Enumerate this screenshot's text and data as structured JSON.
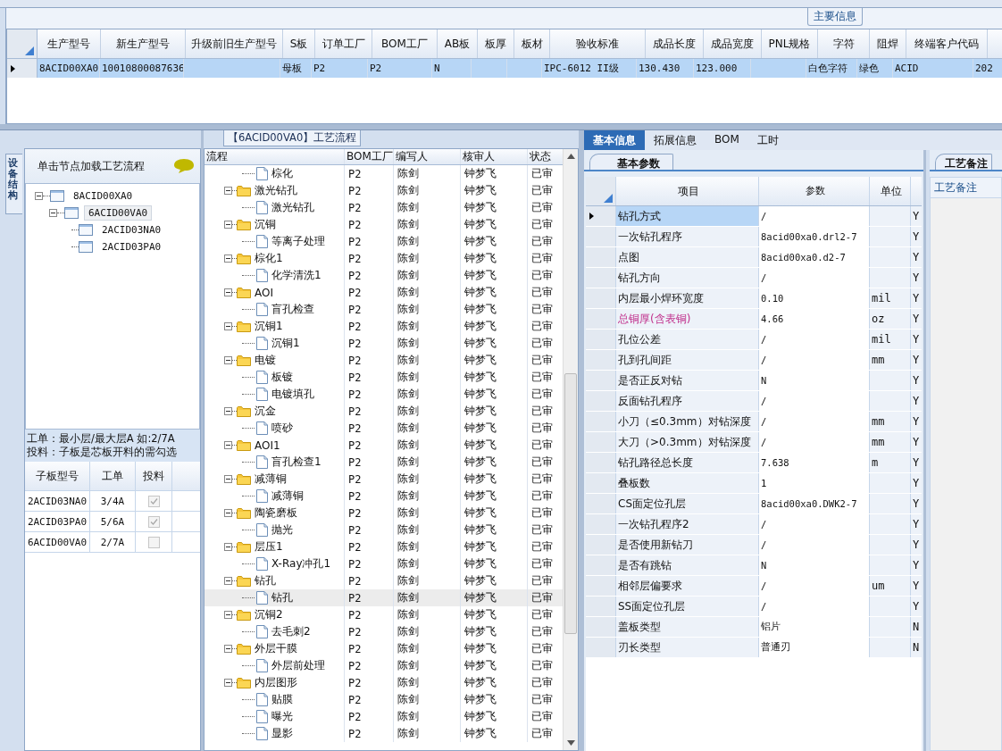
{
  "main_info": {
    "tab": "主要信息",
    "columns": [
      "生产型号",
      "新生产型号",
      "升级前旧生产型号",
      "S板",
      "订单工厂",
      "BOM工厂",
      "AB板",
      "板厚",
      "板材",
      "验收标准",
      "成品长度",
      "成品宽度",
      "PNL规格",
      "字符",
      "阻焊",
      "终端客户代码"
    ],
    "rows": [
      {
        "selected": true,
        "cells": [
          "8ACID00XA0",
          "10010800087636",
          null,
          "母板",
          "P2",
          "P2",
          "N",
          null,
          null,
          "IPC-6012 II级",
          "130.430",
          "123.000",
          null,
          "白色字符",
          "绿色",
          "ACID",
          "202"
        ]
      }
    ]
  },
  "left_panel": {
    "side_tab": "设备结构",
    "hint": "单击节点加载工艺流程",
    "tree": [
      {
        "label": "8ACID00XA0",
        "expanded": true,
        "selected": false,
        "children": [
          {
            "label": "6ACID00VA0",
            "expanded": true,
            "selected": true,
            "children": [
              {
                "label": "2ACID03NA0",
                "selected": false
              },
              {
                "label": "2ACID03PA0",
                "selected": false
              }
            ]
          }
        ]
      }
    ],
    "notes": [
      "工单：最小层/最大层A 如:2/7A",
      "投料：子板是芯板开料的需勾选"
    ],
    "boards": {
      "columns": [
        "子板型号",
        "工单",
        "投料"
      ],
      "rows": [
        {
          "board": "2ACID03NA0",
          "order": "3/4A",
          "checked": true
        },
        {
          "board": "2ACID03PA0",
          "order": "5/6A",
          "checked": true
        },
        {
          "board": "6ACID00VA0",
          "order": "2/7A",
          "checked": false
        }
      ]
    }
  },
  "flow": {
    "title": "【6ACID00VA0】工艺流程",
    "columns": [
      "流程",
      "BOM工厂",
      "编写人",
      "核审人",
      "状态"
    ],
    "rows": [
      {
        "kind": "step",
        "name": "棕化",
        "factory": "P2",
        "writer": "陈剑",
        "reviewer": "钟梦飞",
        "status": "已审",
        "selected": false
      },
      {
        "kind": "group",
        "name": "激光钻孔",
        "factory": "P2",
        "writer": "陈剑",
        "reviewer": "钟梦飞",
        "status": "已审",
        "selected": false,
        "expanded": true,
        "children": [
          {
            "kind": "step",
            "name": "激光钻孔",
            "factory": "P2",
            "writer": "陈剑",
            "reviewer": "钟梦飞",
            "status": "已审",
            "selected": false
          }
        ]
      },
      {
        "kind": "group",
        "name": "沉铜",
        "factory": "P2",
        "writer": "陈剑",
        "reviewer": "钟梦飞",
        "status": "已审",
        "selected": false,
        "expanded": true,
        "children": [
          {
            "kind": "step",
            "name": "等离子处理",
            "factory": "P2",
            "writer": "陈剑",
            "reviewer": "钟梦飞",
            "status": "已审",
            "selected": false
          }
        ]
      },
      {
        "kind": "group",
        "name": "棕化1",
        "factory": "P2",
        "writer": "陈剑",
        "reviewer": "钟梦飞",
        "status": "已审",
        "selected": false,
        "expanded": true,
        "children": [
          {
            "kind": "step",
            "name": "化学清洗1",
            "factory": "P2",
            "writer": "陈剑",
            "reviewer": "钟梦飞",
            "status": "已审",
            "selected": false
          }
        ]
      },
      {
        "kind": "group",
        "name": "AOI",
        "factory": "P2",
        "writer": "陈剑",
        "reviewer": "钟梦飞",
        "status": "已审",
        "selected": false,
        "expanded": true,
        "children": [
          {
            "kind": "step",
            "name": "盲孔检查",
            "factory": "P2",
            "writer": "陈剑",
            "reviewer": "钟梦飞",
            "status": "已审",
            "selected": false
          }
        ]
      },
      {
        "kind": "group",
        "name": "沉铜1",
        "factory": "P2",
        "writer": "陈剑",
        "reviewer": "钟梦飞",
        "status": "已审",
        "selected": false,
        "expanded": true,
        "children": [
          {
            "kind": "step",
            "name": "沉铜1",
            "factory": "P2",
            "writer": "陈剑",
            "reviewer": "钟梦飞",
            "status": "已审",
            "selected": false
          }
        ]
      },
      {
        "kind": "group",
        "name": "电镀",
        "factory": "P2",
        "writer": "陈剑",
        "reviewer": "钟梦飞",
        "status": "已审",
        "selected": false,
        "expanded": true,
        "children": [
          {
            "kind": "step",
            "name": "板镀",
            "factory": "P2",
            "writer": "陈剑",
            "reviewer": "钟梦飞",
            "status": "已审",
            "selected": false
          },
          {
            "kind": "step",
            "name": "电镀填孔",
            "factory": "P2",
            "writer": "陈剑",
            "reviewer": "钟梦飞",
            "status": "已审",
            "selected": false
          }
        ]
      },
      {
        "kind": "group",
        "name": "沉金",
        "factory": "P2",
        "writer": "陈剑",
        "reviewer": "钟梦飞",
        "status": "已审",
        "selected": false,
        "expanded": true,
        "children": [
          {
            "kind": "step",
            "name": "喷砂",
            "factory": "P2",
            "writer": "陈剑",
            "reviewer": "钟梦飞",
            "status": "已审",
            "selected": false
          }
        ]
      },
      {
        "kind": "group",
        "name": "AOI1",
        "factory": "P2",
        "writer": "陈剑",
        "reviewer": "钟梦飞",
        "status": "已审",
        "selected": false,
        "expanded": true,
        "children": [
          {
            "kind": "step",
            "name": "盲孔检查1",
            "factory": "P2",
            "writer": "陈剑",
            "reviewer": "钟梦飞",
            "status": "已审",
            "selected": false
          }
        ]
      },
      {
        "kind": "group",
        "name": "减薄铜",
        "factory": "P2",
        "writer": "陈剑",
        "reviewer": "钟梦飞",
        "status": "已审",
        "selected": false,
        "expanded": true,
        "children": [
          {
            "kind": "step",
            "name": "减薄铜",
            "factory": "P2",
            "writer": "陈剑",
            "reviewer": "钟梦飞",
            "status": "已审",
            "selected": false
          }
        ]
      },
      {
        "kind": "group",
        "name": "陶瓷磨板",
        "factory": "P2",
        "writer": "陈剑",
        "reviewer": "钟梦飞",
        "status": "已审",
        "selected": false,
        "expanded": true,
        "children": [
          {
            "kind": "step",
            "name": "抛光",
            "factory": "P2",
            "writer": "陈剑",
            "reviewer": "钟梦飞",
            "status": "已审",
            "selected": false
          }
        ]
      },
      {
        "kind": "group",
        "name": "层压1",
        "factory": "P2",
        "writer": "陈剑",
        "reviewer": "钟梦飞",
        "status": "已审",
        "selected": false,
        "expanded": true,
        "children": [
          {
            "kind": "step",
            "name": "X-Ray冲孔1",
            "factory": "P2",
            "writer": "陈剑",
            "reviewer": "钟梦飞",
            "status": "已审",
            "selected": false
          }
        ]
      },
      {
        "kind": "group",
        "name": "钻孔",
        "factory": "P2",
        "writer": "陈剑",
        "reviewer": "钟梦飞",
        "status": "已审",
        "selected": false,
        "expanded": true,
        "children": [
          {
            "kind": "step",
            "name": "钻孔",
            "factory": "P2",
            "writer": "陈剑",
            "reviewer": "钟梦飞",
            "status": "已审",
            "selected": true
          }
        ]
      },
      {
        "kind": "group",
        "name": "沉铜2",
        "factory": "P2",
        "writer": "陈剑",
        "reviewer": "钟梦飞",
        "status": "已审",
        "selected": false,
        "expanded": true,
        "children": [
          {
            "kind": "step",
            "name": "去毛刺2",
            "factory": "P2",
            "writer": "陈剑",
            "reviewer": "钟梦飞",
            "status": "已审",
            "selected": false
          }
        ]
      },
      {
        "kind": "group",
        "name": "外层干膜",
        "factory": "P2",
        "writer": "陈剑",
        "reviewer": "钟梦飞",
        "status": "已审",
        "selected": false,
        "expanded": true,
        "children": [
          {
            "kind": "step",
            "name": "外层前处理",
            "factory": "P2",
            "writer": "陈剑",
            "reviewer": "钟梦飞",
            "status": "已审",
            "selected": false
          }
        ]
      },
      {
        "kind": "group",
        "name": "内层图形",
        "factory": "P2",
        "writer": "陈剑",
        "reviewer": "钟梦飞",
        "status": "已审",
        "selected": false,
        "expanded": true,
        "children": [
          {
            "kind": "step",
            "name": "贴膜",
            "factory": "P2",
            "writer": "陈剑",
            "reviewer": "钟梦飞",
            "status": "已审",
            "selected": false
          },
          {
            "kind": "step",
            "name": "曝光",
            "factory": "P2",
            "writer": "陈剑",
            "reviewer": "钟梦飞",
            "status": "已审",
            "selected": false
          },
          {
            "kind": "step",
            "name": "显影",
            "factory": "P2",
            "writer": "陈剑",
            "reviewer": "钟梦飞",
            "status": "已审",
            "selected": false
          }
        ]
      }
    ]
  },
  "details": {
    "tabs": [
      {
        "label": "基本信息",
        "selected": true
      },
      {
        "label": "拓展信息",
        "selected": false
      },
      {
        "label": "BOM",
        "selected": false
      },
      {
        "label": "工时",
        "selected": false
      }
    ],
    "section": "基本参数",
    "columns": [
      "项目",
      "参数",
      "单位"
    ],
    "rows": [
      {
        "item": "钻孔方式",
        "value": "/",
        "flag": "Y",
        "selected": true,
        "emphasis": false
      },
      {
        "item": "一次钻孔程序",
        "value": "8acid00xa0.drl2-7",
        "flag": "Y",
        "selected": false,
        "emphasis": false
      },
      {
        "item": "点图",
        "value": "8acid00xa0.d2-7",
        "flag": "Y",
        "selected": false,
        "emphasis": false
      },
      {
        "item": "钻孔方向",
        "value": "/",
        "flag": "Y",
        "selected": false,
        "emphasis": false
      },
      {
        "item": "内层最小焊环宽度",
        "value": "0.10",
        "unit": "mil",
        "flag": "Y",
        "selected": false,
        "emphasis": false
      },
      {
        "item": "总铜厚(含表铜)",
        "value": "4.66",
        "unit": "oz",
        "flag": "Y",
        "selected": false,
        "emphasis": true
      },
      {
        "item": "孔位公差",
        "value": "/",
        "unit": "mil",
        "flag": "Y",
        "selected": false,
        "emphasis": false
      },
      {
        "item": "孔到孔间距",
        "value": "/",
        "unit": "mm",
        "flag": "Y",
        "selected": false,
        "emphasis": false
      },
      {
        "item": "是否正反对钻",
        "value": "N",
        "flag": "Y",
        "selected": false,
        "emphasis": false
      },
      {
        "item": "反面钻孔程序",
        "value": "/",
        "flag": "Y",
        "selected": false,
        "emphasis": false
      },
      {
        "item": "小刀（≤0.3mm）对钻深度",
        "value": "/",
        "unit": "mm",
        "flag": "Y",
        "selected": false,
        "emphasis": false
      },
      {
        "item": "大刀（>0.3mm）对钻深度",
        "value": "/",
        "unit": "mm",
        "flag": "Y",
        "selected": false,
        "emphasis": false
      },
      {
        "item": "钻孔路径总长度",
        "value": "7.638",
        "unit": "m",
        "flag": "Y",
        "selected": false,
        "emphasis": false
      },
      {
        "item": "叠板数",
        "value": "1",
        "flag": "Y",
        "selected": false,
        "emphasis": false
      },
      {
        "item": "CS面定位孔层",
        "value": "8acid00xa0.DWK2-7",
        "flag": "Y",
        "selected": false,
        "emphasis": false
      },
      {
        "item": "一次钻孔程序2",
        "value": "/",
        "flag": "Y",
        "selected": false,
        "emphasis": false
      },
      {
        "item": "是否使用新钻刀",
        "value": "/",
        "flag": "Y",
        "selected": false,
        "emphasis": false
      },
      {
        "item": "是否有跳钻",
        "value": "N",
        "flag": "Y",
        "selected": false,
        "emphasis": false
      },
      {
        "item": "相邻层偏要求",
        "value": "/",
        "unit": "um",
        "flag": "Y",
        "selected": false,
        "emphasis": false
      },
      {
        "item": "SS面定位孔层",
        "value": "/",
        "flag": "Y",
        "selected": false,
        "emphasis": false
      },
      {
        "item": "盖板类型",
        "value": "铝片",
        "flag": "N",
        "selected": false,
        "emphasis": false
      },
      {
        "item": "刃长类型",
        "value": "普通刃",
        "flag": "N",
        "selected": false,
        "emphasis": false
      }
    ]
  },
  "remarks": {
    "tab": "工艺备注",
    "label": "工艺备注"
  }
}
